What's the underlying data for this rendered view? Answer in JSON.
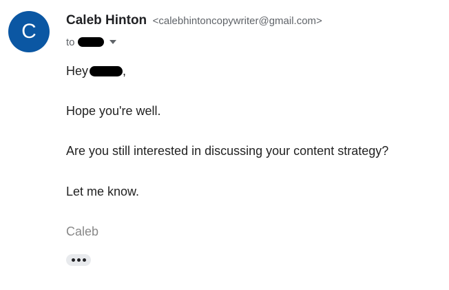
{
  "sender": {
    "avatar_letter": "C",
    "avatar_color": "#0b57a3",
    "name": "Caleb Hinton",
    "email": "<calebhintoncopywriter@gmail.com>"
  },
  "recipient": {
    "to_label": "to"
  },
  "message": {
    "greeting": "Hey",
    "greeting_suffix": ",",
    "lines": [
      "Hope you're well.",
      "Are you still interested in discussing your content strategy?",
      "Let me know."
    ],
    "signature": "Caleb"
  },
  "icons": {
    "recipient_details": "caret-down-icon",
    "show_trimmed_content": "more-horiz-icon"
  }
}
